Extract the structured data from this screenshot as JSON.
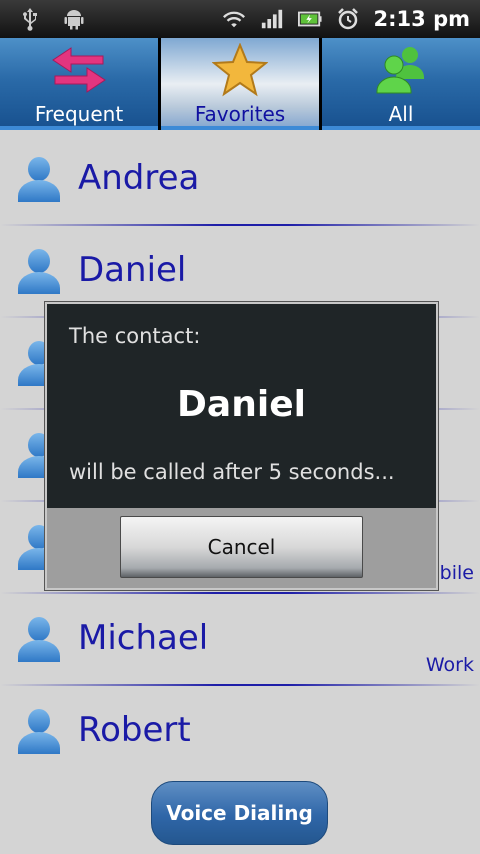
{
  "status_bar": {
    "time": "2:13 pm",
    "icons": [
      "usb-icon",
      "android-debug-icon",
      "wifi-icon",
      "signal-icon",
      "battery-icon",
      "alarm-icon"
    ]
  },
  "tabs": [
    {
      "label": "Frequent",
      "icon": "swap-arrows-icon",
      "active": false
    },
    {
      "label": "Favorites",
      "icon": "star-icon",
      "active": true
    },
    {
      "label": "All",
      "icon": "people-group-icon",
      "active": false
    }
  ],
  "contacts": [
    {
      "name": "Andrea",
      "type": ""
    },
    {
      "name": "Daniel",
      "type": ""
    },
    {
      "name": "",
      "type": ""
    },
    {
      "name": "",
      "type": ""
    },
    {
      "name": "",
      "type": "obile"
    },
    {
      "name": "Michael",
      "type": "Work"
    },
    {
      "name": "Robert",
      "type": ""
    }
  ],
  "voice_button": {
    "label": "Voice Dialing"
  },
  "dialog": {
    "prompt": "The contact:",
    "contact_name": "Daniel",
    "message": "will be called after 5 seconds...",
    "cancel_label": "Cancel"
  },
  "colors": {
    "accent_blue": "#1a1aa6",
    "tab_blue": "#2a6aa8",
    "dialog_bg": "#1f2527"
  }
}
